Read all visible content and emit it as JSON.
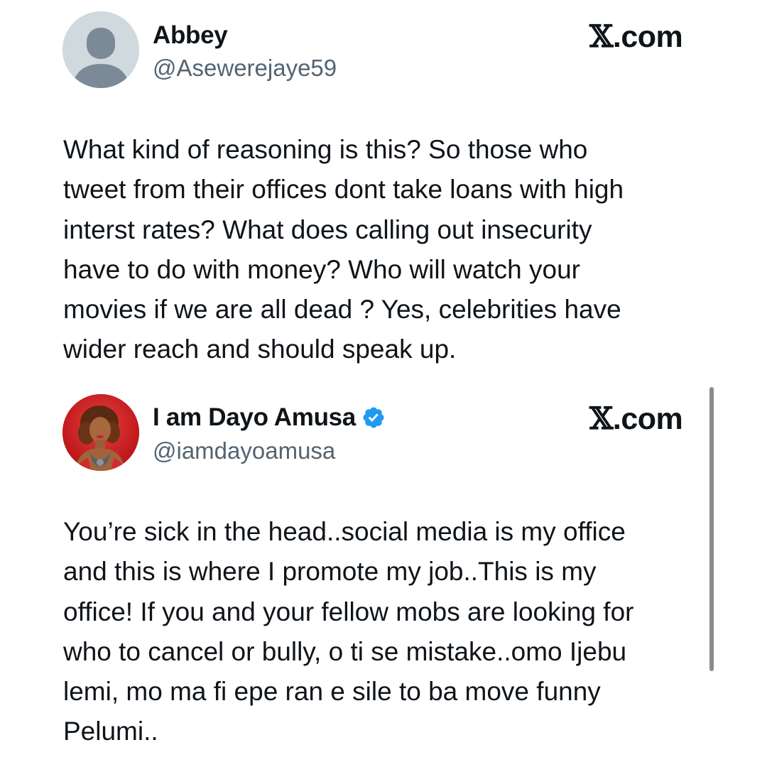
{
  "tweets": [
    {
      "display_name": "Abbey",
      "handle": "@Asewerejaye59",
      "brand": ".com",
      "brand_logo": "𝕏",
      "avatar": "default-avatar-icon",
      "verified": false,
      "lines": [
        "What kind of reasoning is this? So those who",
        "tweet from their offices dont take loans with high",
        "interst rates? What does calling out insecurity",
        "have to do with money? Who will watch your",
        "movies if we are all dead ? Yes, celebrities have",
        "wider reach and should speak up."
      ]
    },
    {
      "display_name": "I am Dayo Amusa",
      "handle": "@iamdayoamusa",
      "brand": ".com",
      "brand_logo": "𝕏",
      "avatar": "profile-photo",
      "verified": true,
      "lines": [
        "You’re sick in the head..social media is my office",
        "and this is where I promote my job..This is my",
        "office! If you and your fellow mobs are looking for",
        "who to cancel or bully, o ti se mistake..omo Ijebu",
        "lemi, mo ma fi epe ran e sile to ba move funny",
        "Pelumi.."
      ]
    }
  ],
  "colors": {
    "text": "#0f1419",
    "handle": "#536471",
    "verified": "#1d9bf0",
    "default_avatar_bg": "#cfd9de",
    "default_avatar_fg": "#7b8a96",
    "profile_bg": "#c8161c"
  }
}
